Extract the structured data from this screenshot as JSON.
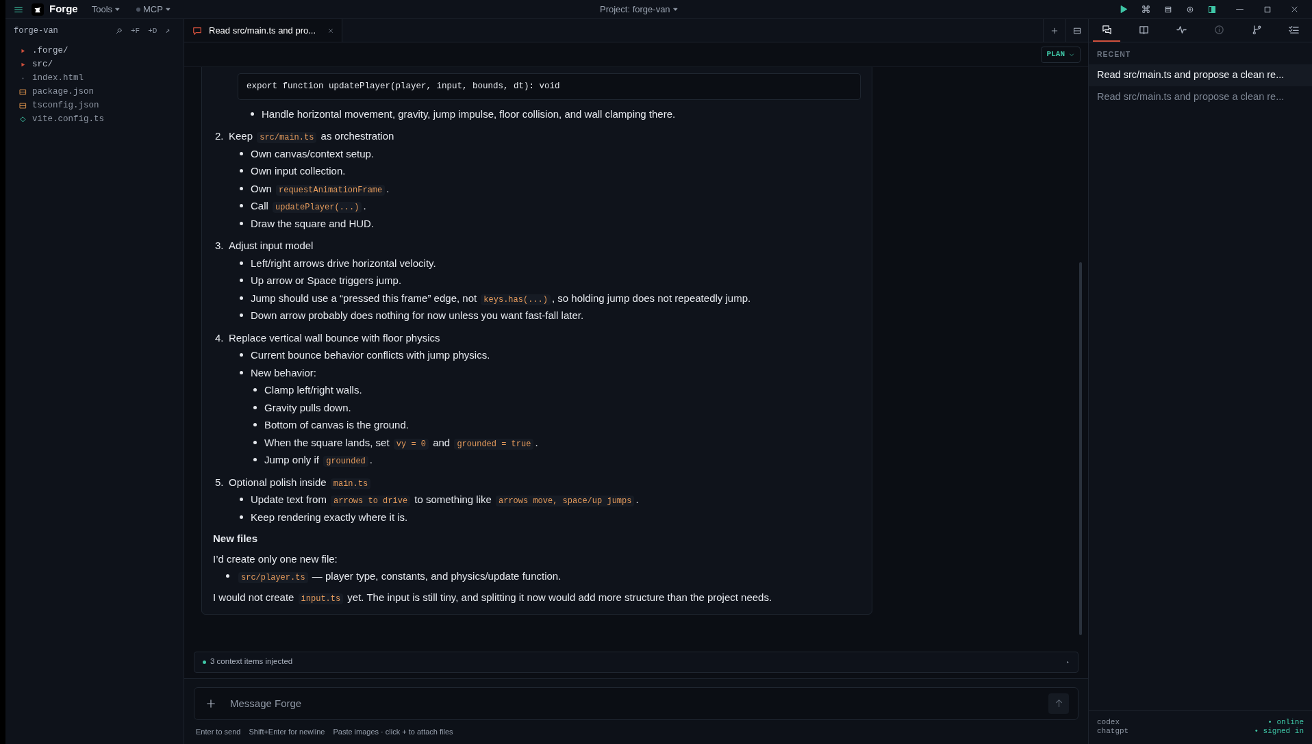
{
  "titlebar": {
    "app": "Forge",
    "menus": [
      {
        "label": "Tools",
        "status": false
      },
      {
        "label": "MCP",
        "status": true
      }
    ],
    "project": "Project: forge-van"
  },
  "sidebar": {
    "title": "forge-van",
    "actions": [
      "+F",
      "+D",
      "↗"
    ],
    "tree": [
      {
        "kind": "folder",
        "name": ".forge/"
      },
      {
        "kind": "folder",
        "name": "src/"
      },
      {
        "kind": "file",
        "name": "index.html"
      },
      {
        "kind": "data",
        "name": "package.json"
      },
      {
        "kind": "data",
        "name": "tsconfig.json"
      },
      {
        "kind": "config",
        "name": "vite.config.ts"
      }
    ]
  },
  "tabs": [
    {
      "label": "Read src/main.ts and pro...",
      "selected": true
    }
  ],
  "toolbar": {
    "mode": "PLAN"
  },
  "message": [
    {
      "kind": "continued",
      "children": [
        {
          "kind": "code_block",
          "text": "export function updatePlayer(player, input, bounds, dt): void"
        },
        {
          "kind": "bullets",
          "items": [
            {
              "parts": [
                {
                  "kind": "text",
                  "text": "Handle horizontal movement, gravity, jump impulse, floor collision, and wall clamping there."
                }
              ]
            }
          ]
        }
      ]
    },
    {
      "kind": "step",
      "number": "2.",
      "parts": [
        {
          "kind": "text",
          "text": "Keep "
        },
        {
          "kind": "code",
          "text": "src/main.ts"
        },
        {
          "kind": "text",
          "text": " as orchestration"
        }
      ],
      "items": [
        {
          "parts": [
            {
              "kind": "text",
              "text": "Own canvas/context setup."
            }
          ]
        },
        {
          "parts": [
            {
              "kind": "text",
              "text": "Own input collection."
            }
          ]
        },
        {
          "parts": [
            {
              "kind": "text",
              "text": "Own "
            },
            {
              "kind": "code",
              "text": "requestAnimationFrame"
            },
            {
              "kind": "text",
              "text": "."
            }
          ]
        },
        {
          "parts": [
            {
              "kind": "text",
              "text": "Call "
            },
            {
              "kind": "code",
              "text": "updatePlayer(...)"
            },
            {
              "kind": "text",
              "text": "."
            }
          ]
        },
        {
          "parts": [
            {
              "kind": "text",
              "text": "Draw the square and HUD."
            }
          ]
        }
      ]
    },
    {
      "kind": "step",
      "number": "3.",
      "parts": [
        {
          "kind": "text",
          "text": "Adjust input model"
        }
      ],
      "items": [
        {
          "parts": [
            {
              "kind": "text",
              "text": "Left/right arrows drive horizontal velocity."
            }
          ]
        },
        {
          "parts": [
            {
              "kind": "text",
              "text": "Up arrow or Space triggers jump."
            }
          ]
        },
        {
          "parts": [
            {
              "kind": "text",
              "text": "Jump should use a “pressed this frame” edge, not "
            },
            {
              "kind": "code",
              "text": "keys.has(...)"
            },
            {
              "kind": "text",
              "text": ", so holding jump does not repeatedly jump."
            }
          ]
        },
        {
          "parts": [
            {
              "kind": "text",
              "text": "Down arrow probably does nothing for now unless you want fast-fall later."
            }
          ]
        }
      ]
    },
    {
      "kind": "step",
      "number": "4.",
      "parts": [
        {
          "kind": "text",
          "text": "Replace vertical wall bounce with floor physics"
        }
      ],
      "items": [
        {
          "parts": [
            {
              "kind": "text",
              "text": "Current bounce behavior conflicts with jump physics."
            }
          ]
        },
        {
          "parts": [
            {
              "kind": "text",
              "text": "New behavior:"
            }
          ],
          "children": [
            {
              "parts": [
                {
                  "kind": "text",
                  "text": "Clamp left/right walls."
                }
              ]
            },
            {
              "parts": [
                {
                  "kind": "text",
                  "text": "Gravity pulls down."
                }
              ]
            },
            {
              "parts": [
                {
                  "kind": "text",
                  "text": "Bottom of canvas is the ground."
                }
              ]
            },
            {
              "parts": [
                {
                  "kind": "text",
                  "text": "When the square lands, set "
                },
                {
                  "kind": "code",
                  "text": "vy = 0"
                },
                {
                  "kind": "text",
                  "text": " and "
                },
                {
                  "kind": "code",
                  "text": "grounded = true"
                },
                {
                  "kind": "text",
                  "text": "."
                }
              ]
            },
            {
              "parts": [
                {
                  "kind": "text",
                  "text": "Jump only if "
                },
                {
                  "kind": "code",
                  "text": "grounded"
                },
                {
                  "kind": "text",
                  "text": "."
                }
              ]
            }
          ]
        }
      ]
    },
    {
      "kind": "step",
      "number": "5.",
      "parts": [
        {
          "kind": "text",
          "text": "Optional polish inside "
        },
        {
          "kind": "code",
          "text": "main.ts"
        }
      ],
      "items": [
        {
          "parts": [
            {
              "kind": "text",
              "text": "Update text from "
            },
            {
              "kind": "code",
              "text": "arrows to drive"
            },
            {
              "kind": "text",
              "text": " to something like "
            },
            {
              "kind": "code",
              "text": "arrows move, space/up jumps"
            },
            {
              "kind": "text",
              "text": "."
            }
          ]
        },
        {
          "parts": [
            {
              "kind": "text",
              "text": "Keep rendering exactly where it is."
            }
          ]
        }
      ]
    },
    {
      "kind": "heading",
      "text": "New files"
    },
    {
      "kind": "paragraph",
      "parts": [
        {
          "kind": "text",
          "text": "I’d create only one new file:"
        }
      ]
    },
    {
      "kind": "bullets",
      "items": [
        {
          "parts": [
            {
              "kind": "code",
              "text": "src/player.ts"
            },
            {
              "kind": "text",
              "text": " — player type, constants, and physics/update function."
            }
          ]
        }
      ]
    },
    {
      "kind": "paragraph",
      "parts": [
        {
          "kind": "text",
          "text": "I would not create "
        },
        {
          "kind": "code",
          "text": "input.ts"
        },
        {
          "kind": "text",
          "text": " yet. The input is still tiny, and splitting it now would add more structure than the project needs."
        }
      ]
    }
  ],
  "context": {
    "text": "3 context items injected"
  },
  "composer": {
    "placeholder": "Message Forge",
    "hints": [
      "Enter to send",
      "Shift+Enter for newline",
      "Paste images · click + to attach files"
    ]
  },
  "panel": {
    "tabs": [
      {
        "kind": "chat",
        "selected": true
      },
      {
        "kind": "book",
        "selected": false
      },
      {
        "kind": "activity",
        "selected": false
      },
      {
        "kind": "info",
        "selected": false
      },
      {
        "kind": "branch",
        "selected": false
      },
      {
        "kind": "checklist",
        "selected": false
      }
    ],
    "section": "RECENT",
    "items": [
      {
        "label": "Read src/main.ts and propose a clean re...",
        "selected": true
      },
      {
        "label": "Read src/main.ts and propose a clean re...",
        "selected": false
      }
    ],
    "status": [
      {
        "name": "codex",
        "state": "• online"
      },
      {
        "name": "chatgpt",
        "state": "• signed in"
      }
    ]
  }
}
